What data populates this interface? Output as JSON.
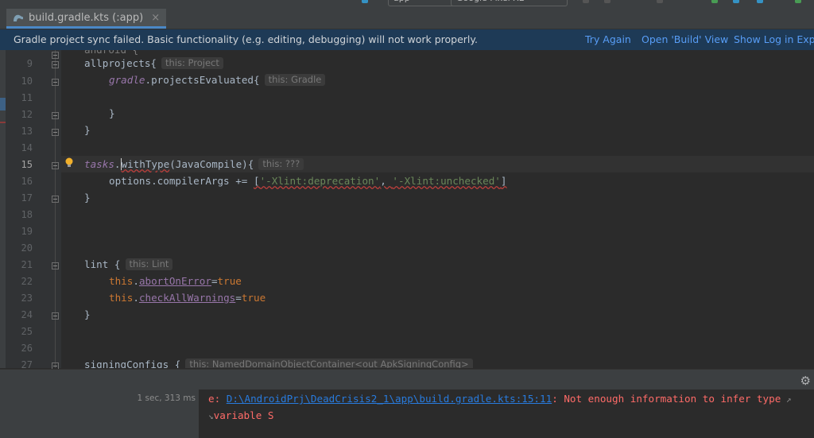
{
  "tab": {
    "label": "build.gradle.kts (:app)",
    "close": "×"
  },
  "toolbar": {
    "config": "app",
    "device": "Google Pixel XL"
  },
  "banner": {
    "message": "Gradle project sync failed. Basic functionality (e.g. editing, debugging) will not work properly.",
    "try_again": "Try Again",
    "open_build": "Open 'Build' View",
    "show_log": "Show Log in Explo"
  },
  "editor": {
    "line_numbers": [
      "9",
      "10",
      "11",
      "12",
      "13",
      "14",
      "15",
      "16",
      "17",
      "18",
      "19",
      "20",
      "21",
      "22",
      "23",
      "24",
      "25",
      "26",
      "27"
    ],
    "current_line": "15",
    "hints": {
      "project": "this: Project",
      "gradle": "this: Gradle",
      "unknown": "this: ???",
      "lint": "this: Lint",
      "signing": "this: NamedDomainObjectContainer<out ApkSigningConfig>"
    },
    "code": {
      "l9": "allprojects{",
      "l10_a": "gradle",
      "l10_b": ".projectsEvaluated{",
      "l12": "}",
      "l13": "}",
      "l15_a": "tasks",
      "l15_b": ".",
      "l15_c": "withType",
      "l15_d": "(JavaCompile){",
      "l16_a": "options.compilerArgs += ",
      "l16_b": "[",
      "l16_c": "'-Xlint:deprecation'",
      "l16_d": ", ",
      "l16_e": "'-Xlint:unchecked'",
      "l16_f": "]",
      "l17": "}",
      "l21": "lint {",
      "l22_a": "this",
      "l22_b": ".",
      "l22_c": "abortOnError",
      "l22_d": "=",
      "l22_e": "true",
      "l23_a": "this",
      "l23_b": ".",
      "l23_c": "checkAllWarnings",
      "l23_d": "=",
      "l23_e": "true",
      "l24": "}",
      "l27": "signingConfigs {"
    }
  },
  "build": {
    "duration": "1 sec, 313 ms",
    "error_prefix": "e: ",
    "error_path": "D:\\AndroidPrj\\DeadCrisis2_1\\app\\build.gradle.kts:15:11",
    "error_message": ": Not enough information to infer type",
    "error_line2": "variable S"
  },
  "colors": {
    "banner_bg": "#1e3a56",
    "link": "#589df6",
    "error": "#ff6b68",
    "keyword": "#cc7832",
    "string": "#6a8759",
    "field": "#9876aa"
  }
}
